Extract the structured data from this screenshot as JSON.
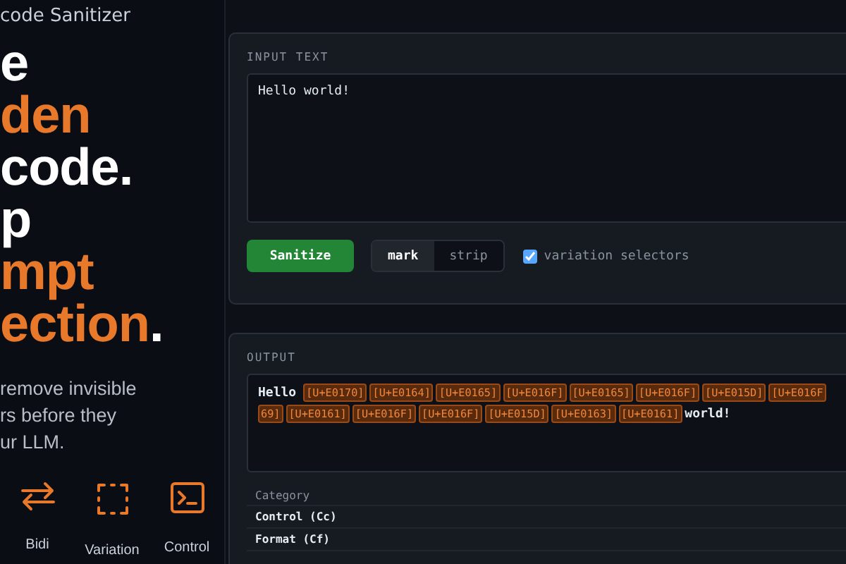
{
  "brand": {
    "title": "code Sanitizer"
  },
  "headline": [
    {
      "segments": [
        {
          "text": "e",
          "accent": false
        }
      ]
    },
    {
      "segments": [
        {
          "text": "den",
          "accent": true
        }
      ]
    },
    {
      "segments": [
        {
          "text": "code.",
          "accent": false
        }
      ]
    },
    {
      "segments": [
        {
          "text": "p",
          "accent": false
        }
      ]
    },
    {
      "segments": [
        {
          "text": "mpt",
          "accent": true
        }
      ]
    },
    {
      "segments": [
        {
          "text": "ection",
          "accent": true
        },
        {
          "text": ".",
          "accent": false
        }
      ]
    }
  ],
  "intro": [
    "remove invisible",
    "rs before they",
    "ur LLM."
  ],
  "features": [
    {
      "kind": "bidi",
      "label": "Bidi"
    },
    {
      "kind": "variation",
      "label": "Variation"
    },
    {
      "kind": "control",
      "label": "Control"
    }
  ],
  "input": {
    "label": "INPUT TEXT",
    "value": "Hello world!",
    "action": "Sanitize",
    "modes": [
      {
        "label": "mark",
        "selected": true
      },
      {
        "label": "strip",
        "selected": false
      }
    ],
    "option": {
      "label": "variation selectors",
      "checked": true
    }
  },
  "output": {
    "label": "OUTPUT",
    "lines": [
      [
        {
          "kind": "text",
          "text": "Hello"
        },
        {
          "kind": "chip",
          "text": "[U+E0170]"
        },
        {
          "kind": "chip",
          "text": "[U+E0164]"
        },
        {
          "kind": "chip",
          "text": "[U+E0165]"
        },
        {
          "kind": "chip",
          "text": "[U+E016F]"
        },
        {
          "kind": "chip",
          "text": "[U+E0165]"
        },
        {
          "kind": "chip",
          "text": "[U+E016F]"
        },
        {
          "kind": "chip",
          "text": "[U+E015D]"
        },
        {
          "kind": "chip",
          "text": "[U+E016F"
        }
      ],
      [
        {
          "kind": "chip",
          "text": "69]"
        },
        {
          "kind": "chip",
          "text": "[U+E0161]"
        },
        {
          "kind": "chip",
          "text": "[U+E016F]"
        },
        {
          "kind": "chip",
          "text": "[U+E016F]"
        },
        {
          "kind": "chip",
          "text": "[U+E015D]"
        },
        {
          "kind": "chip",
          "text": "[U+E0163]"
        },
        {
          "kind": "chip",
          "text": "[U+E0161]"
        },
        {
          "kind": "text",
          "text": "world!"
        }
      ]
    ]
  },
  "table": {
    "header": "Category",
    "rows": [
      "Control (Cc)",
      "Format (Cf)"
    ]
  }
}
